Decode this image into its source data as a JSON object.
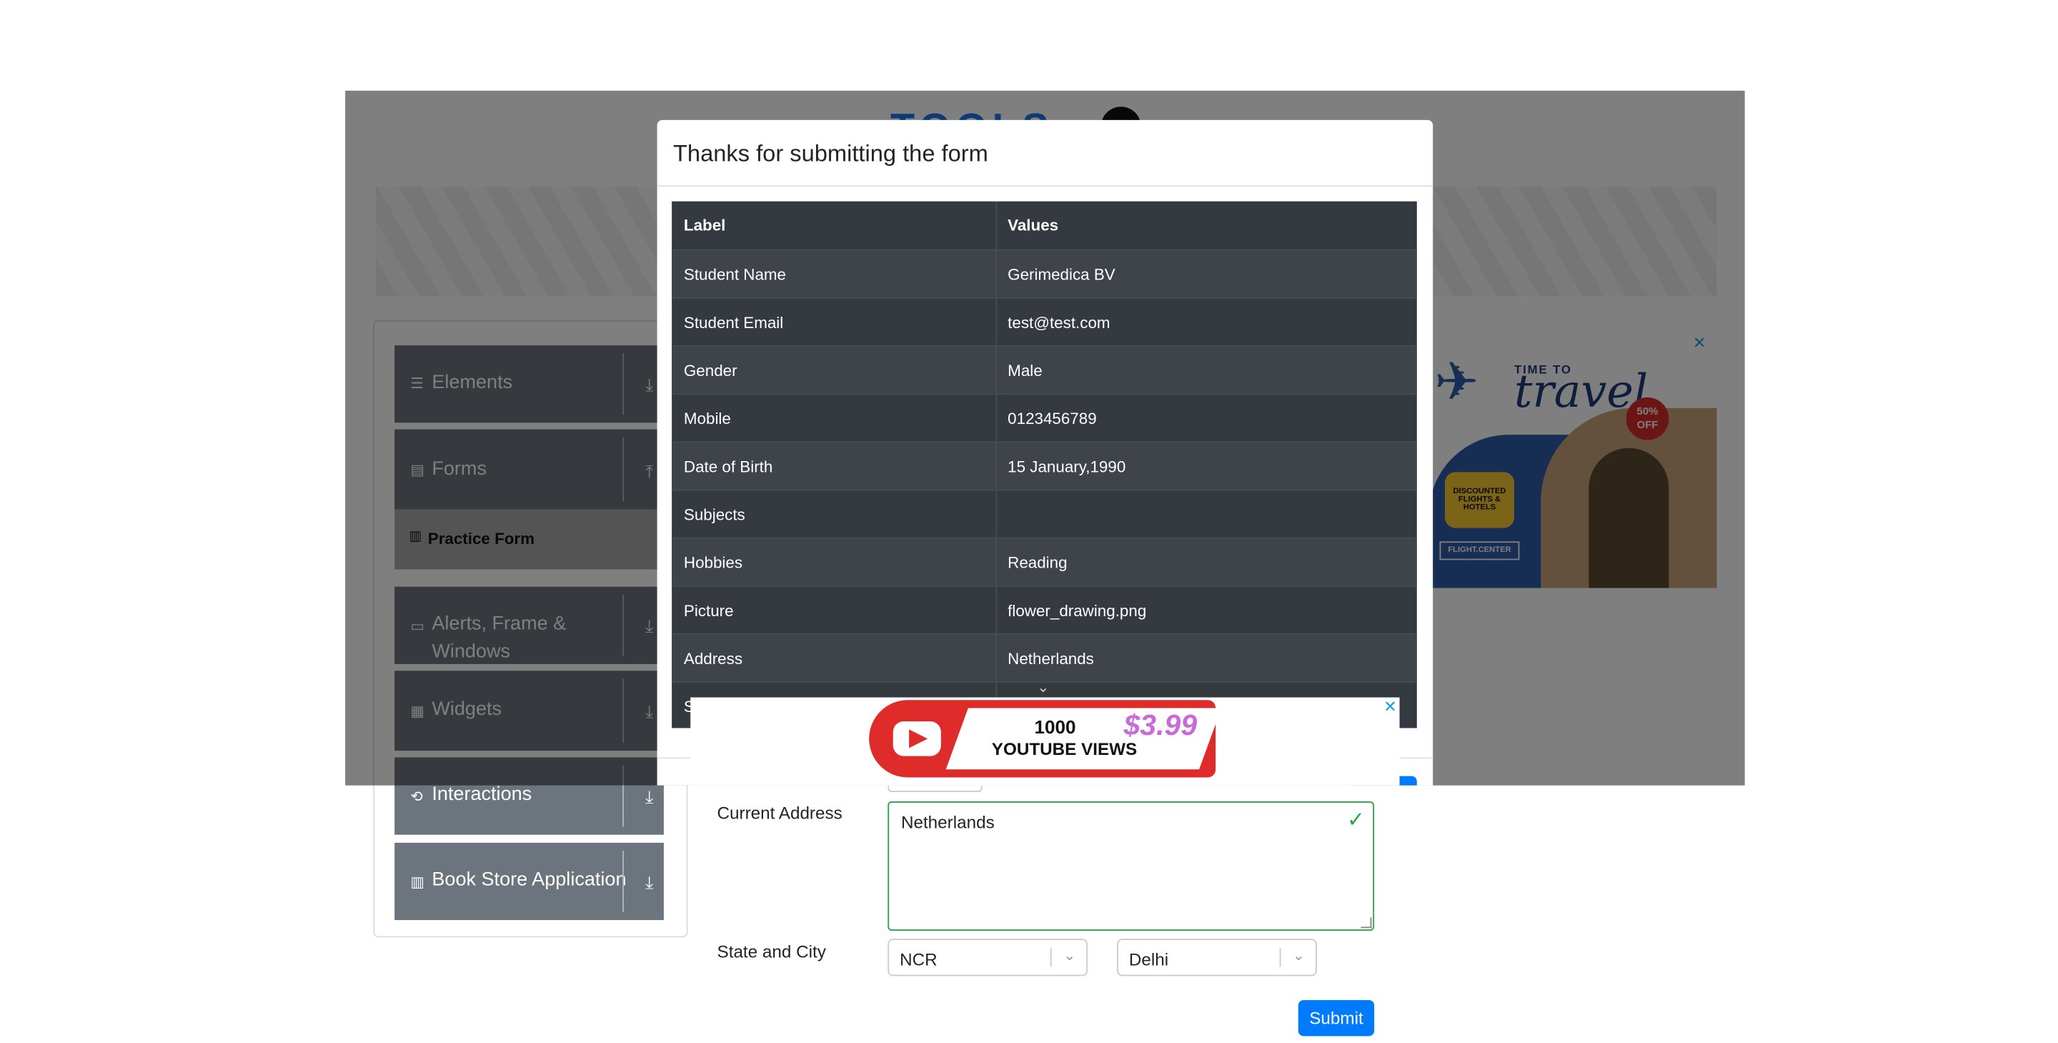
{
  "sidebar": {
    "groups": [
      {
        "label": "Elements",
        "icon": "list-icon",
        "arrow": "⤓"
      },
      {
        "label": "Forms",
        "icon": "form-icon",
        "arrow": "⤒"
      },
      {
        "label": "Alerts, Frame &",
        "label2": "Windows",
        "icon": "window-icon",
        "arrow": "⤓"
      },
      {
        "label": "Widgets",
        "icon": "widgets-icon",
        "arrow": "⤓"
      },
      {
        "label": "Interactions",
        "icon": "interactions-icon",
        "arrow": "⤓"
      },
      {
        "label": "Book Store Application",
        "icon": "books-icon",
        "arrow": "⤓"
      }
    ],
    "active_item": "Practice Form"
  },
  "ads": {
    "travel": {
      "line1": "TIME TO",
      "line2": "travel",
      "badge": "50% OFF",
      "bubble": "DISCOUNTED FLIGHTS & HOTELS",
      "brand": "FLIGHT.CENTER",
      "close": "✕"
    },
    "youtube": {
      "line1": "1000",
      "line2": "YOUTUBE VIEWS",
      "price": "$3.99",
      "close": "✕"
    }
  },
  "form": {
    "current_address_label": "Current Address",
    "current_address_value": "Netherlands",
    "state_city_label": "State and City",
    "state_value": "NCR",
    "city_value": "Delhi",
    "submit_label": "Submit"
  },
  "modal": {
    "title": "Thanks for submitting the form",
    "headers": {
      "label": "Label",
      "values": "Values"
    },
    "rows": [
      {
        "label": "Student Name",
        "value": "Gerimedica BV"
      },
      {
        "label": "Student Email",
        "value": "test@test.com"
      },
      {
        "label": "Gender",
        "value": "Male"
      },
      {
        "label": "Mobile",
        "value": "0123456789"
      },
      {
        "label": "Date of Birth",
        "value": "15 January,1990"
      },
      {
        "label": "Subjects",
        "value": ""
      },
      {
        "label": "Hobbies",
        "value": "Reading"
      },
      {
        "label": "Picture",
        "value": "flower_drawing.png"
      },
      {
        "label": "Address",
        "value": "Netherlands"
      },
      {
        "label": "S",
        "value": ""
      }
    ]
  },
  "colors": {
    "primary": "#007bff",
    "success": "#28a745",
    "table_dark": "#343a40",
    "sidebar": "#6c757d"
  }
}
